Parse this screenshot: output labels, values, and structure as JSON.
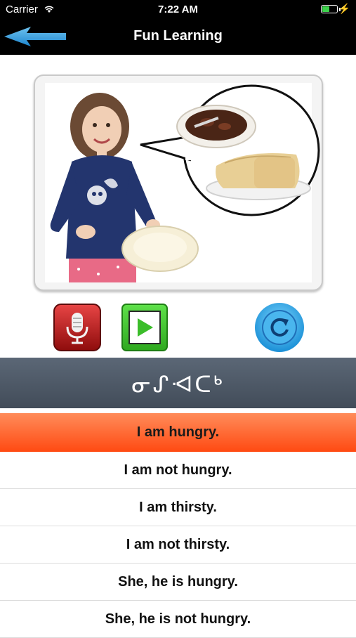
{
  "status_bar": {
    "carrier": "Carrier",
    "time": "7:22 AM",
    "battery_level": 0.55
  },
  "nav": {
    "title": "Fun Learning",
    "back_icon": "back-arrow-icon"
  },
  "illustration": {
    "description_icon": "girl-hungry-speech-bubble"
  },
  "controls": {
    "record_icon": "microphone-icon",
    "play_icon": "play-icon",
    "replay_icon": "replay-icon"
  },
  "syllabics": "ᓂᔑᐗᑕᒃ",
  "phrases": [
    {
      "label": "I am hungry.",
      "selected": true
    },
    {
      "label": "I am not hungry.",
      "selected": false
    },
    {
      "label": "I am thirsty.",
      "selected": false
    },
    {
      "label": "I am not thirsty.",
      "selected": false
    },
    {
      "label": "She, he is hungry.",
      "selected": false
    },
    {
      "label": "She, he is not hungry.",
      "selected": false
    }
  ],
  "colors": {
    "selected_row": "#ff5a1f",
    "banner": "#4a5563",
    "nav_bg": "#000000",
    "accent_blue": "#2aa8e8"
  }
}
